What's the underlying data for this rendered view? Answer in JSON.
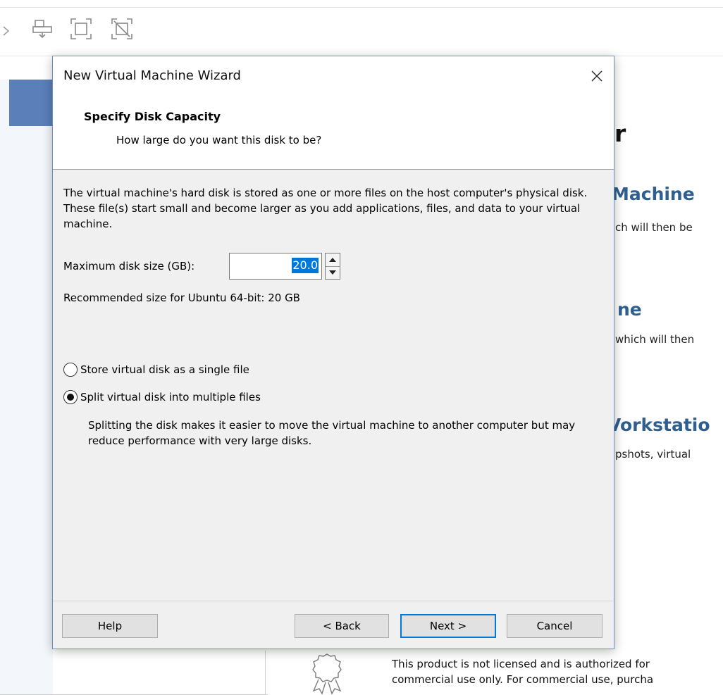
{
  "background_app": {
    "toolbar": {
      "icons": [
        "dropdown-arrow-icon",
        "send-ctrl-alt-del-icon",
        "fit-window-icon",
        "exit-fullscreen-icon"
      ]
    },
    "home": {
      "fragment_r": "r",
      "fragment_machine": "Machine",
      "fragment_machine_body": "ch will then be",
      "fragment_ne": "ne",
      "fragment_ne_body": "which will then",
      "fragment_workstation": "Vorkstatio",
      "fragment_workstation_body": "pshots, virtual"
    },
    "license": {
      "icon": "ribbon-badge-icon",
      "line1": "This product is not licensed and is authorized for",
      "line2": "commercial use only. For commercial use, purcha"
    }
  },
  "dialog": {
    "title": "New Virtual Machine Wizard",
    "close_icon": "close-icon",
    "header_title": "Specify Disk Capacity",
    "header_subtitle": "How large do you want this disk to be?",
    "description": "The virtual machine's hard disk is stored as one or more files on the host computer's physical disk. These file(s) start small and become larger as you add applications, files, and data to your virtual machine.",
    "max_size_label": "Maximum disk size (GB):",
    "max_size_value": "20.0",
    "recommended": "Recommended size for Ubuntu 64-bit: 20 GB",
    "options": [
      {
        "label": "Store virtual disk as a single file",
        "checked": false
      },
      {
        "label": "Split virtual disk into multiple files",
        "checked": true
      }
    ],
    "split_description": "Splitting the disk makes it easier to move the virtual machine to another computer but may reduce performance with very large disks.",
    "buttons": {
      "help": "Help",
      "back": "< Back",
      "next": "Next >",
      "cancel": "Cancel"
    }
  },
  "colors": {
    "accent": "#0078d7",
    "sidebar_highlight": "#5a7fb9",
    "heading_blue": "#2f5f8f",
    "dialog_bg": "#f0f0f0"
  }
}
